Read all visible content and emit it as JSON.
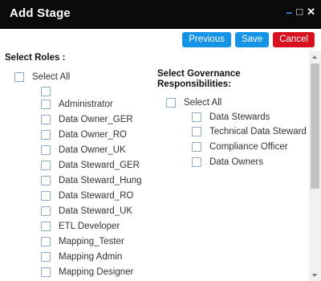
{
  "window": {
    "title": "Add Stage",
    "minimize_glyph": "–",
    "maximize_glyph": "□",
    "close_glyph": "✕"
  },
  "toolbar": {
    "previous_label": "Previous",
    "save_label": "Save",
    "cancel_label": "Cancel"
  },
  "roles": {
    "heading": "Select Roles :",
    "select_all_label": "Select All",
    "items": [
      "",
      "Administrator",
      "Data Owner_GER",
      "Data Owner_RO",
      "Data Owner_UK",
      "Data Steward_GER",
      "Data Steward_Hung",
      "Data Steward_RO",
      "Data Steward_UK",
      "ETL Developer",
      "Mapping_Tester",
      "Mapping Admin",
      "Mapping Designer"
    ]
  },
  "governance": {
    "heading_line1": "Select Governance",
    "heading_line2": "Responsibilities:",
    "select_all_label": "Select All",
    "items": [
      "Data Stewards",
      "Technical Data Steward",
      "Compliance Officer",
      "Data Owners"
    ]
  },
  "colors": {
    "titlebar_bg": "#0a0a0a",
    "primary_button": "#1593e6",
    "cancel_button": "#d9111f",
    "checkbox_border": "#8ea9c5"
  }
}
